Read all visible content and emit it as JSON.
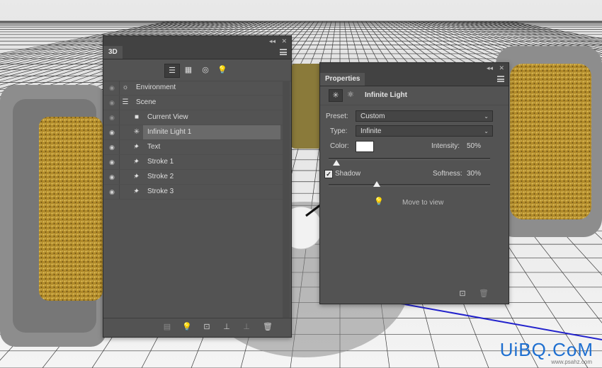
{
  "colors": {
    "panel_bg": "#535353",
    "header_bg": "#424242",
    "selection": "#6a6a6a",
    "axis_red": "#d52020",
    "axis_blue": "#2020cc",
    "gold": "#b08a2a"
  },
  "panel3d": {
    "tab_label": "3D",
    "collapse_glyph": "◂◂",
    "close_glyph": "✕",
    "filter_icons": [
      "scene-filter-icon",
      "mesh-filter-icon",
      "material-filter-icon",
      "light-filter-icon"
    ],
    "filter_glyphs": [
      "☰",
      "▦",
      "◎",
      "💡"
    ],
    "rows": [
      {
        "name": "environment",
        "label": "Environment",
        "eye": "◉",
        "eye_dim": true,
        "twirl": "",
        "icon": "☼",
        "indent": 0
      },
      {
        "name": "scene",
        "label": "Scene",
        "eye": "◉",
        "eye_dim": true,
        "twirl": "",
        "icon": "☰",
        "indent": 0
      },
      {
        "name": "current-view",
        "label": "Current View",
        "eye": "◉",
        "eye_dim": true,
        "twirl": "",
        "icon": "■",
        "indent": 1
      },
      {
        "name": "infinite-light-1",
        "label": "Infinite Light 1",
        "eye": "◉",
        "eye_dim": false,
        "twirl": "",
        "icon": "✳",
        "indent": 1,
        "selected": true
      },
      {
        "name": "text",
        "label": "Text",
        "eye": "◉",
        "eye_dim": false,
        "twirl": "›",
        "icon": "✦",
        "indent": 1
      },
      {
        "name": "stroke-1",
        "label": "Stroke 1",
        "eye": "◉",
        "eye_dim": false,
        "twirl": "›",
        "icon": "✦",
        "indent": 1
      },
      {
        "name": "stroke-2",
        "label": "Stroke 2",
        "eye": "◉",
        "eye_dim": false,
        "twirl": "›",
        "icon": "✦",
        "indent": 1
      },
      {
        "name": "stroke-3",
        "label": "Stroke 3",
        "eye": "◉",
        "eye_dim": false,
        "twirl": "›",
        "icon": "✦",
        "indent": 1
      }
    ],
    "bottom_icons": [
      "render-icon",
      "add-light-icon",
      "scene-cube-icon",
      "drop-to-plane-icon",
      "delete-light-icon",
      "trash-icon"
    ],
    "bottom_glyphs": [
      "▤",
      "💡",
      "⊡",
      "⊥",
      "⊥",
      "🗑"
    ]
  },
  "properties": {
    "tab_label": "Properties",
    "collapse_glyph": "◂◂",
    "close_glyph": "✕",
    "head_icons": [
      "light-mode-icon",
      "coordinates-mode-icon"
    ],
    "head_glyphs": [
      "✳",
      "⚛"
    ],
    "title": "Infinite Light",
    "preset_label": "Preset:",
    "preset_value": "Custom",
    "type_label": "Type:",
    "type_value": "Infinite",
    "color_label": "Color:",
    "color_value": "#ffffff",
    "intensity_label": "Intensity:",
    "intensity_value": "50%",
    "intensity_fraction": 0.05,
    "shadow_label": "Shadow",
    "shadow_checked": true,
    "softness_label": "Softness:",
    "softness_value": "30%",
    "softness_fraction": 0.3,
    "move_to_view_label": "Move to view",
    "move_glyph": "💡",
    "bottom_glyphs": [
      "⊡",
      "🗑"
    ],
    "chevron": "⌄"
  },
  "watermark": {
    "logo_text": "UiBQ.CoM",
    "url": "www.psahz.com"
  }
}
